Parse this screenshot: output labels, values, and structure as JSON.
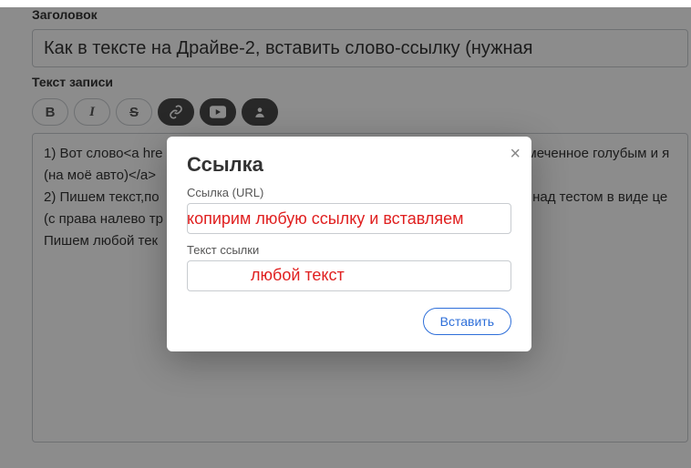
{
  "header": {
    "title_label": "Заголовок",
    "title_value": "Как в тексте на Драйве-2, вставить слово-ссылку (нужная "
  },
  "body": {
    "textarea_label": "Текст записи",
    "content_line1": "1) Вот слово<a hre",
    "content_line1_tail": "меченное голубым и я",
    "content_line2": "(на моё авто)</a>",
    "content_line3_a": " 2) Пишем текст,по",
    "content_line3_b": "\" над тестом в виде це",
    "content_line4": "(с права налево тр",
    "content_line5": "Пишем любой тек"
  },
  "toolbar": {
    "bold": "B",
    "italic": "I",
    "strike": "S"
  },
  "modal": {
    "title": "Ссылка",
    "url_label": "Ссылка (URL)",
    "text_label": "Текст ссылки",
    "insert_label": "Вставить",
    "close_symbol": "×"
  },
  "annotations": {
    "url_hint": "копирим любую ссылку и вставляем",
    "text_hint": "любой текст"
  }
}
